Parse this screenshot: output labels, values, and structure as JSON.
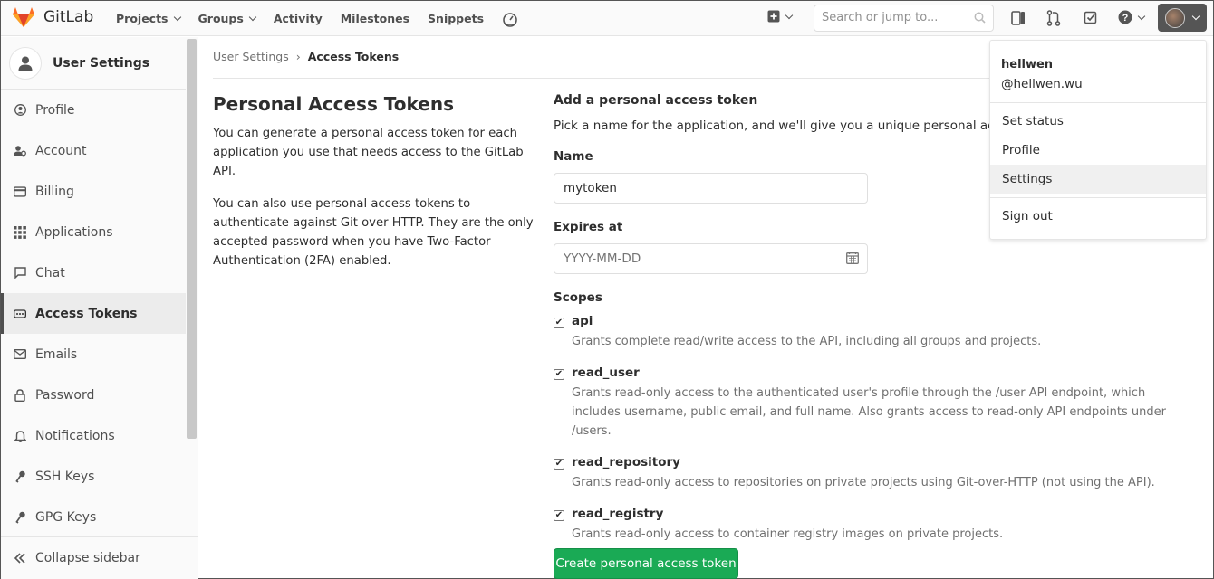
{
  "topnav": {
    "brand": "GitLab",
    "links": [
      {
        "label": "Projects",
        "dropdown": true
      },
      {
        "label": "Groups",
        "dropdown": true
      },
      {
        "label": "Activity",
        "dropdown": false
      },
      {
        "label": "Milestones",
        "dropdown": false
      },
      {
        "label": "Snippets",
        "dropdown": false
      }
    ],
    "search_placeholder": "Search or jump to...",
    "icons": [
      "performance-icon",
      "plus-square-icon",
      "search-icon",
      "todo-sidebar-icon",
      "merge-request-icon",
      "issues-check-icon",
      "help-icon",
      "user-avatar"
    ]
  },
  "sidebar": {
    "title": "User Settings",
    "items": [
      {
        "label": "Profile",
        "icon": "profile-icon"
      },
      {
        "label": "Account",
        "icon": "account-icon"
      },
      {
        "label": "Billing",
        "icon": "billing-icon"
      },
      {
        "label": "Applications",
        "icon": "applications-icon"
      },
      {
        "label": "Chat",
        "icon": "chat-icon"
      },
      {
        "label": "Access Tokens",
        "icon": "token-icon",
        "active": true
      },
      {
        "label": "Emails",
        "icon": "email-icon"
      },
      {
        "label": "Password",
        "icon": "lock-icon"
      },
      {
        "label": "Notifications",
        "icon": "bell-icon"
      },
      {
        "label": "SSH Keys",
        "icon": "key-icon"
      },
      {
        "label": "GPG Keys",
        "icon": "key-icon"
      }
    ],
    "collapse": "Collapse sidebar"
  },
  "breadcrumb": {
    "parent": "User Settings",
    "current": "Access Tokens"
  },
  "intro": {
    "title": "Personal Access Tokens",
    "p1": "You can generate a personal access token for each application you use that needs access to the GitLab API.",
    "p2": "You can also use personal access tokens to authenticate against Git over HTTP. They are the only accepted password when you have Two-Factor Authentication (2FA) enabled."
  },
  "form": {
    "heading": "Add a personal access token",
    "lead": "Pick a name for the application, and we'll give you a unique personal access to",
    "name_label": "Name",
    "name_value": "mytoken",
    "expires_label": "Expires at",
    "expires_placeholder": "YYYY-MM-DD",
    "scopes_label": "Scopes",
    "scopes": [
      {
        "name": "api",
        "checked": true,
        "desc": "Grants complete read/write access to the API, including all groups and projects."
      },
      {
        "name": "read_user",
        "checked": true,
        "desc": "Grants read-only access to the authenticated user's profile through the /user API endpoint, which includes username, public email, and full name. Also grants access to read-only API endpoints under /users."
      },
      {
        "name": "read_repository",
        "checked": true,
        "desc": "Grants read-only access to repositories on private projects using Git-over-HTTP (not using the API)."
      },
      {
        "name": "read_registry",
        "checked": true,
        "desc": "Grants read-only access to container registry images on private projects."
      }
    ],
    "submit": "Create personal access token"
  },
  "user_menu": {
    "name": "hellwen",
    "handle": "@hellwen.wu",
    "items": [
      "Set status",
      "Profile",
      "Settings"
    ],
    "highlighted": "Settings",
    "signout": "Sign out"
  }
}
